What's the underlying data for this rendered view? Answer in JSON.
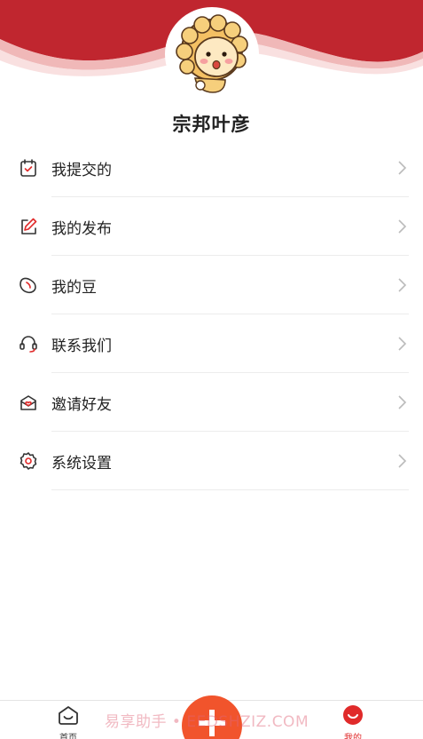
{
  "profile": {
    "username": "宗邦叶彦"
  },
  "menu": {
    "items": [
      {
        "key": "submitted",
        "label": "我提交的",
        "icon": "calendar-check-icon"
      },
      {
        "key": "posts",
        "label": "我的发布",
        "icon": "edit-pencil-icon"
      },
      {
        "key": "beans",
        "label": "我的豆",
        "icon": "bean-icon"
      },
      {
        "key": "contact",
        "label": "联系我们",
        "icon": "headset-icon"
      },
      {
        "key": "invite",
        "label": "邀请好友",
        "icon": "invite-envelope-icon"
      },
      {
        "key": "settings",
        "label": "系统设置",
        "icon": "gear-icon"
      }
    ]
  },
  "tabbar": {
    "home_label": "首页",
    "mine_label": "我的"
  },
  "watermark": "易享助手 • EEDSHZIZ.COM",
  "colors": {
    "brand_red": "#c0262f",
    "fab_orange": "#f1542c",
    "active_tab": "#e02a2a"
  }
}
